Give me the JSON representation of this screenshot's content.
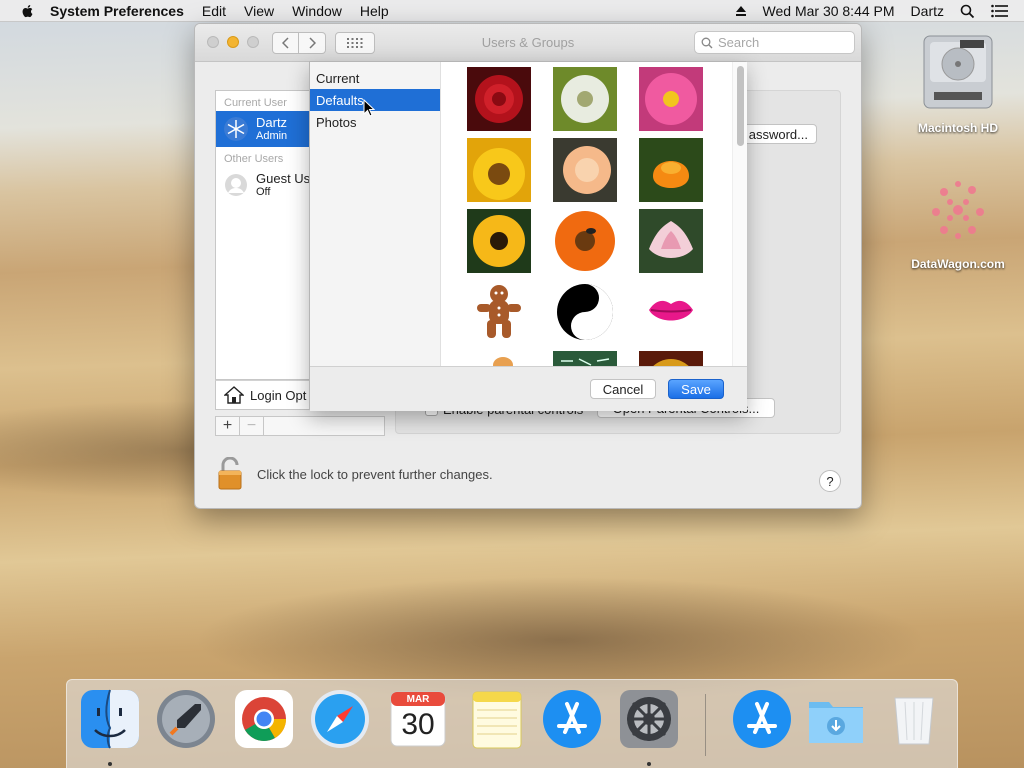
{
  "menubar": {
    "app_name": "System Preferences",
    "menus": [
      "Edit",
      "View",
      "Window",
      "Help"
    ],
    "datetime": "Wed Mar 30  8:44 PM",
    "user": "Dartz"
  },
  "desktop": {
    "icons": [
      {
        "label": "Macintosh HD",
        "icon": "hard-drive-icon"
      },
      {
        "label": "DataWagon.com",
        "icon": "flower-image-icon"
      }
    ]
  },
  "window": {
    "title": "Users & Groups",
    "search_placeholder": "Search",
    "users": {
      "current_label": "Current User",
      "current": {
        "name": "Dartz",
        "role": "Admin"
      },
      "other_label": "Other Users",
      "others": [
        {
          "name": "Guest Us",
          "status": "Off"
        }
      ],
      "login_options": "Login Opt"
    },
    "password_button": "assword...",
    "parental_label": "Enable parental controls",
    "parental_button": "Open Parental Controls...",
    "lock_text": "Click the lock to prevent further changes.",
    "help": "?"
  },
  "picker": {
    "sources": [
      {
        "label": "Current",
        "selected": false
      },
      {
        "label": "Defaults",
        "selected": true
      },
      {
        "label": "Photos",
        "selected": false
      }
    ],
    "thumbnails": [
      "rose",
      "dandelion",
      "pink-dahlia",
      "sunflower",
      "peach-rose",
      "orange-poppy",
      "black-eyed-susan",
      "orange-gerbera",
      "lotus",
      "gingerbread-man",
      "yin-yang",
      "lips",
      "leaf",
      "chalkboard",
      "golden-ball"
    ],
    "cancel": "Cancel",
    "save": "Save"
  },
  "dock": {
    "apps": [
      "finder",
      "launchpad",
      "chrome",
      "safari",
      "calendar",
      "notes",
      "app-store",
      "system-preferences",
      "app-store-download",
      "downloads-folder",
      "trash"
    ],
    "calendar": {
      "month": "MAR",
      "day": "30"
    }
  },
  "colors": {
    "selection": "#1f6fd6",
    "save_button": "#1b6fe6",
    "minimize": "#f3b431"
  }
}
